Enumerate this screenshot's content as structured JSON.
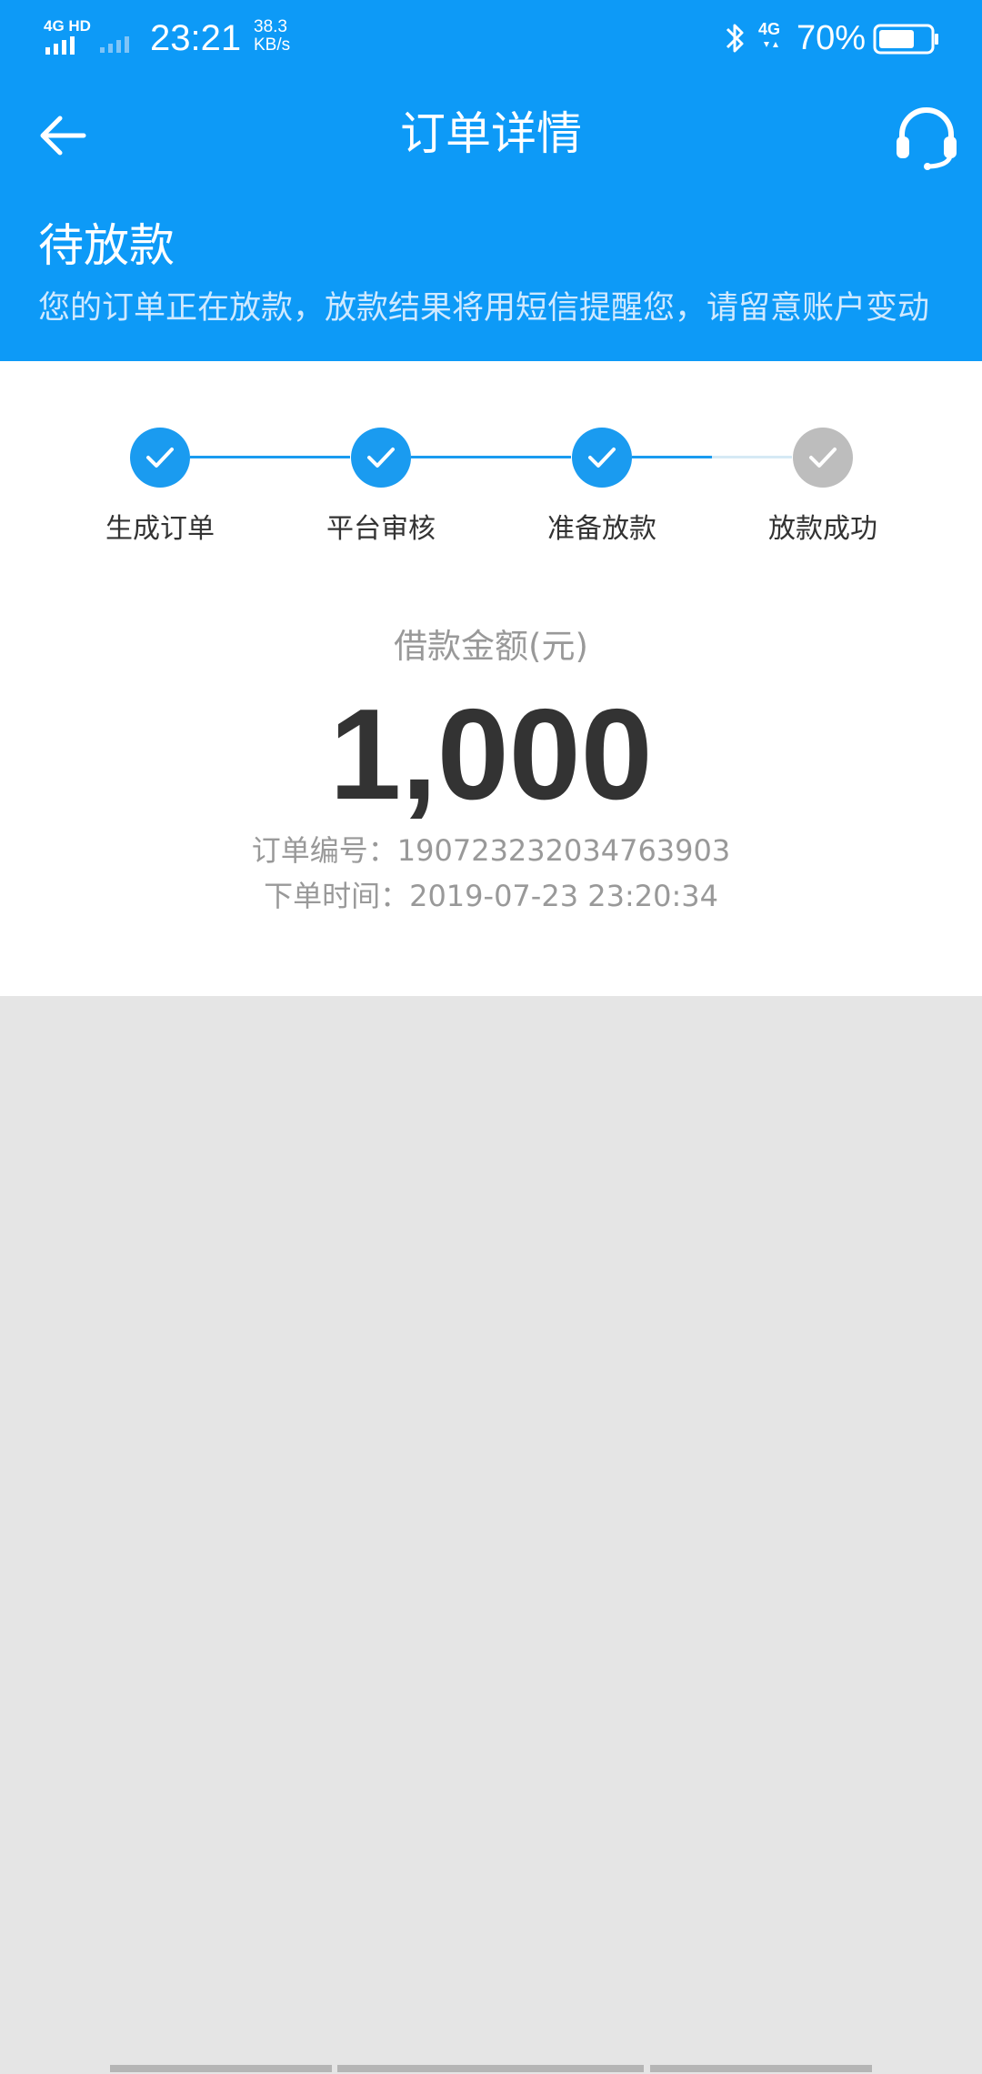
{
  "status_bar": {
    "network_label": "4G HD",
    "time": "23:21",
    "speed_value": "38.3",
    "speed_unit": "KB/s",
    "secondary_network": "4G",
    "battery_percent": "70%",
    "battery_level": 0.7
  },
  "nav": {
    "title": "订单详情",
    "back_icon": "arrow-left-icon",
    "support_icon": "headset-icon"
  },
  "order_status": {
    "title": "待放款",
    "description": "您的订单正在放款，放款结果将用短信提醒您，请留意账户变动"
  },
  "progress": {
    "steps": [
      {
        "label": "生成订单",
        "completed": true
      },
      {
        "label": "平台审核",
        "completed": true
      },
      {
        "label": "准备放款",
        "completed": true
      },
      {
        "label": "放款成功",
        "completed": false
      }
    ]
  },
  "loan": {
    "amount_label": "借款金额(元)",
    "amount": "1,000",
    "order_number_label": "订单编号：",
    "order_number": "190723232034763903",
    "order_time_label": "下单时间：",
    "order_time": "2019-07-23 23:20:34"
  },
  "colors": {
    "primary": "#0d9af7",
    "completed": "#1a9bf0",
    "pending": "#bdbdbd",
    "text_dark": "#333333",
    "text_muted": "#999999",
    "background": "#e5e5e5"
  }
}
